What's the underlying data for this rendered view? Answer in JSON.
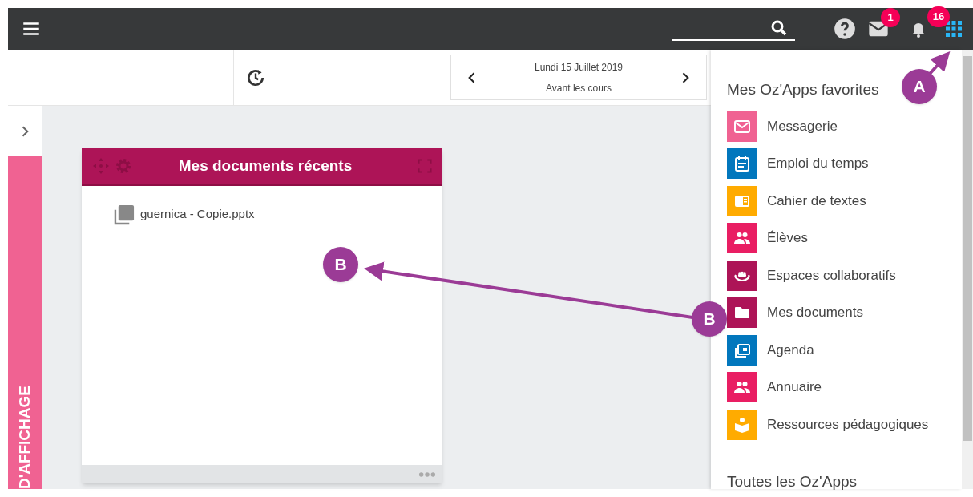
{
  "header": {
    "mail_badge": "1",
    "notifications_badge": "16"
  },
  "toolbar": {
    "date": "Lundi 15 Juillet 2019",
    "period": "Avant les cours"
  },
  "side_strip": {
    "label": "D'AFFICHAGE"
  },
  "widget": {
    "title": "Mes documents récents",
    "files": [
      {
        "name": "guernica - Copie.pptx",
        "kind": "pptx"
      }
    ]
  },
  "favorites": {
    "title": "Mes Oz'Apps favorites",
    "items": [
      {
        "label": "Messagerie",
        "kind": "mail",
        "color": "#f06292"
      },
      {
        "label": "Emploi du temps",
        "kind": "schedule",
        "color": "#0277bd"
      },
      {
        "label": "Cahier de textes",
        "kind": "book",
        "color": "#ffab00"
      },
      {
        "label": "Élèves",
        "kind": "people",
        "color": "#e91e63"
      },
      {
        "label": "Espaces collaboratifs",
        "kind": "collab",
        "color": "#ad1457"
      },
      {
        "label": "Mes documents",
        "kind": "folder",
        "color": "#ad1457"
      },
      {
        "label": "Agenda",
        "kind": "agenda",
        "color": "#0277bd"
      },
      {
        "label": "Annuaire",
        "kind": "people",
        "color": "#e91e63"
      },
      {
        "label": "Ressources pédagogiques",
        "kind": "reader",
        "color": "#ffab00"
      }
    ]
  },
  "all_apps": {
    "title": "Toutes les Oz'Apps"
  },
  "annotations": [
    {
      "label": "A"
    },
    {
      "label": "B"
    },
    {
      "label": "B"
    }
  ]
}
